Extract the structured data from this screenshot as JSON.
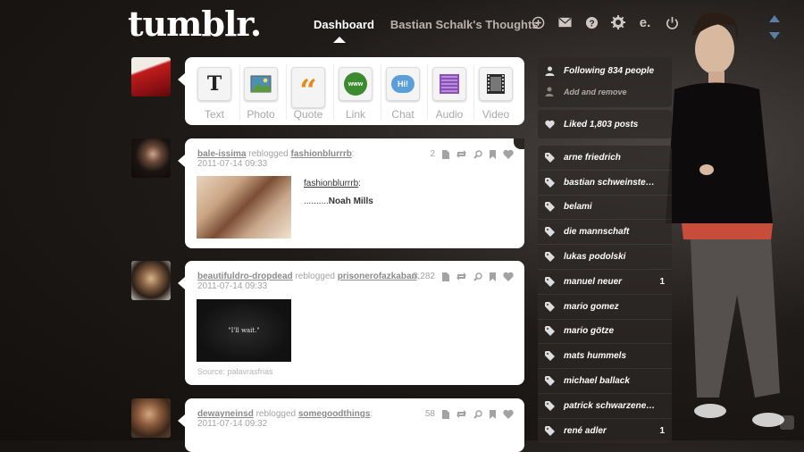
{
  "header": {
    "logo": "tumblr.",
    "nav": {
      "dashboard": "Dashboard",
      "blog": "Bastian Schalk's Thoughts"
    },
    "icons": [
      "plus-circle-icon",
      "mail-icon",
      "help-icon",
      "gear-icon",
      "e-icon",
      "power-icon"
    ],
    "icon_e_text": "e."
  },
  "composer": {
    "buttons": [
      {
        "label": "Text",
        "icon": "text-icon",
        "glyph": "T"
      },
      {
        "label": "Photo",
        "icon": "photo-icon",
        "glyph": ""
      },
      {
        "label": "Quote",
        "icon": "quote-icon",
        "glyph": "“"
      },
      {
        "label": "Link",
        "icon": "link-icon",
        "glyph": "www"
      },
      {
        "label": "Chat",
        "icon": "chat-icon",
        "glyph": "Hi!"
      },
      {
        "label": "Audio",
        "icon": "audio-icon",
        "glyph": ""
      },
      {
        "label": "Video",
        "icon": "video-icon",
        "glyph": ""
      }
    ]
  },
  "posts": [
    {
      "user": "bale-issima",
      "reblogged": "reblogged",
      "source": "fashionblurrrb",
      "colon": ":",
      "date": "2011-07-14 09:33",
      "notes": "2",
      "body_link": "fashionblurrrb",
      "body_link_colon": ":",
      "body_text_prefix": "..........",
      "body_text": "Noah Mills"
    },
    {
      "user": "beautifuldro-dropdead",
      "reblogged": "reblogged",
      "source": "prisonerofazkaban",
      "colon": ":",
      "date": "2011-07-14 09:33",
      "notes": "3,282",
      "image_text": "\"I'll wait.\"",
      "source_line": "Source: palavrasfrias"
    },
    {
      "user": "dewayneinsd",
      "reblogged": "reblogged",
      "source": "somegoodthings",
      "colon": ":",
      "date": "2011-07-14 09:32",
      "notes": "58"
    }
  ],
  "sidebar": {
    "following": "Following 834 people",
    "add_remove": "Add and remove",
    "liked": "Liked 1,803 posts",
    "tags": [
      {
        "name": "arne friedrich",
        "count": ""
      },
      {
        "name": "bastian schweinste…",
        "count": ""
      },
      {
        "name": "belami",
        "count": ""
      },
      {
        "name": "die mannschaft",
        "count": ""
      },
      {
        "name": "lukas podolski",
        "count": ""
      },
      {
        "name": "manuel neuer",
        "count": "1"
      },
      {
        "name": "mario gomez",
        "count": ""
      },
      {
        "name": "mario götze",
        "count": ""
      },
      {
        "name": "mats hummels",
        "count": ""
      },
      {
        "name": "michael ballack",
        "count": ""
      },
      {
        "name": "patrick schwarzene…",
        "count": ""
      },
      {
        "name": "rené adler",
        "count": "1"
      }
    ]
  },
  "colors": {
    "background": "#1a1614",
    "card": "#ffffff",
    "accent": "#5a7ea8"
  }
}
